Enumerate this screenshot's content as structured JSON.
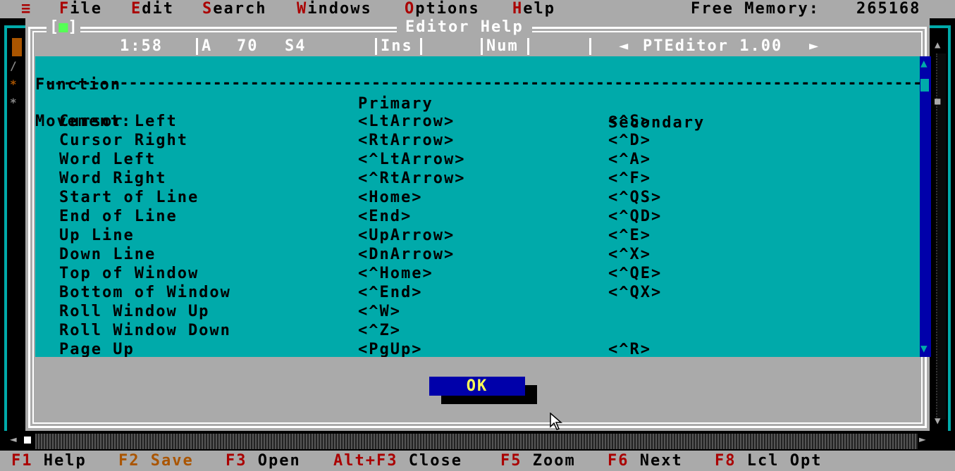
{
  "menubar": {
    "system_icon": "≡",
    "items": [
      {
        "hot": "F",
        "rest": "ile"
      },
      {
        "hot": "E",
        "rest": "dit"
      },
      {
        "hot": "S",
        "rest": "earch"
      },
      {
        "hot": "W",
        "rest": "indows"
      },
      {
        "hot": "O",
        "rest": "ptions"
      },
      {
        "hot": "H",
        "rest": "elp"
      }
    ],
    "free_memory_label": "Free Memory:",
    "free_memory_value": "265168"
  },
  "dialog": {
    "title": "Editor Help",
    "close_box": "[■]",
    "status": {
      "position": "1:58",
      "mode": "A",
      "column": "70",
      "s": "S4",
      "ins": "Ins",
      "num": "Num",
      "app_name": "PTEditor 1.00"
    },
    "help": {
      "headers": {
        "function": "Function",
        "primary": "Primary",
        "secondary": "Secondary"
      },
      "separator": "-------------------------------------------------------------------------------------------------------------------------",
      "section": "Movement:",
      "rows": [
        {
          "function": "Cursor Left",
          "primary": "<LtArrow>",
          "secondary": "<^S>"
        },
        {
          "function": "Cursor Right",
          "primary": "<RtArrow>",
          "secondary": "<^D>"
        },
        {
          "function": "Word Left",
          "primary": "<^LtArrow>",
          "secondary": "<^A>"
        },
        {
          "function": "Word Right",
          "primary": "<^RtArrow>",
          "secondary": "<^F>"
        },
        {
          "function": "Start of Line",
          "primary": "<Home>",
          "secondary": "<^QS>"
        },
        {
          "function": "End of Line",
          "primary": "<End>",
          "secondary": "<^QD>"
        },
        {
          "function": "Up Line",
          "primary": "<UpArrow>",
          "secondary": "<^E>"
        },
        {
          "function": "Down Line",
          "primary": "<DnArrow>",
          "secondary": "<^X>"
        },
        {
          "function": "Top of Window",
          "primary": "<^Home>",
          "secondary": "<^QE>"
        },
        {
          "function": "Bottom of Window",
          "primary": "<^End>",
          "secondary": "<^QX>"
        },
        {
          "function": "Roll Window Up",
          "primary": "<^W>",
          "secondary": ""
        },
        {
          "function": "Roll Window Down",
          "primary": "<^Z>",
          "secondary": ""
        },
        {
          "function": "Page Up",
          "primary": "<PgUp>",
          "secondary": "<^R>"
        }
      ]
    },
    "ok_label": "OK"
  },
  "fkeys": [
    {
      "key": "F1",
      "label": "Help",
      "dim": false
    },
    {
      "key": "F2",
      "label": "Save",
      "dim": true
    },
    {
      "key": "F3",
      "label": "Open",
      "dim": false
    },
    {
      "key": "Alt+F3",
      "label": "Close",
      "dim": false
    },
    {
      "key": "F5",
      "label": "Zoom",
      "dim": false
    },
    {
      "key": "F6",
      "label": "Next",
      "dim": false
    },
    {
      "key": "F8",
      "label": "Lcl Opt",
      "dim": false
    }
  ],
  "colors": {
    "desktop": "#aaaaaa",
    "help_bg": "#00aaaa",
    "hotkey": "#aa0000",
    "button_bg": "#0000aa",
    "button_text": "#ffff55"
  }
}
